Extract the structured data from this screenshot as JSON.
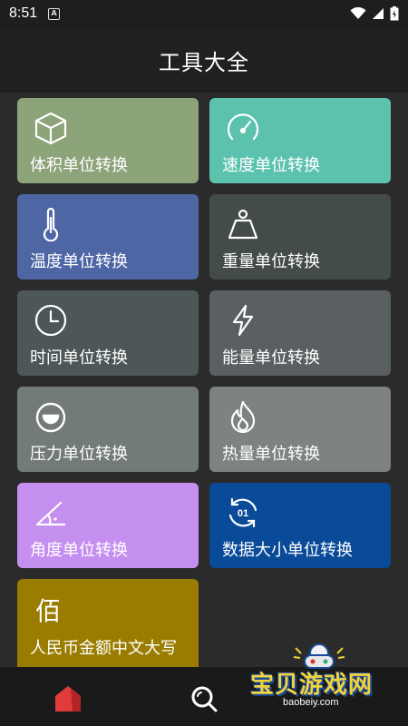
{
  "status_bar": {
    "time": "8:51",
    "notification_glyph": "A",
    "icons": [
      "wifi-icon",
      "signal-icon",
      "battery-icon"
    ]
  },
  "app_bar": {
    "title": "工具大全"
  },
  "tools": [
    {
      "label": "体积单位转换",
      "icon": "cube-icon",
      "color": "#8da37a"
    },
    {
      "label": "速度单位转换",
      "icon": "speedometer-icon",
      "color": "#5cc2ad"
    },
    {
      "label": "温度单位转换",
      "icon": "thermometer-icon",
      "color": "#4e66a4"
    },
    {
      "label": "重量单位转换",
      "icon": "weight-icon",
      "color": "#444b4b"
    },
    {
      "label": "时间单位转换",
      "icon": "clock-icon",
      "color": "#4d5757"
    },
    {
      "label": "能量单位转换",
      "icon": "lightning-icon",
      "color": "#5a5f61"
    },
    {
      "label": "压力单位转换",
      "icon": "pressure-gauge-icon",
      "color": "#737a7a"
    },
    {
      "label": "热量单位转换",
      "icon": "flame-icon",
      "color": "#7e8283"
    },
    {
      "label": "角度单位转换",
      "icon": "angle-icon",
      "color": "#c58ff0"
    },
    {
      "label": "数据大小单位转换",
      "icon": "data-sync-icon",
      "color": "#0a4b99"
    },
    {
      "label": "人民币金额中文大写",
      "icon_char": "佰",
      "icon": "bai-char-icon",
      "color": "#9a7d00"
    }
  ],
  "bottom_nav": {
    "items": [
      {
        "name": "home-icon",
        "active": true,
        "color": "#e23b3b"
      },
      {
        "name": "search-icon",
        "active": false,
        "color": "#ffffff"
      }
    ]
  },
  "watermark": {
    "main": "宝贝游戏网",
    "url": "baobeiy.com"
  }
}
